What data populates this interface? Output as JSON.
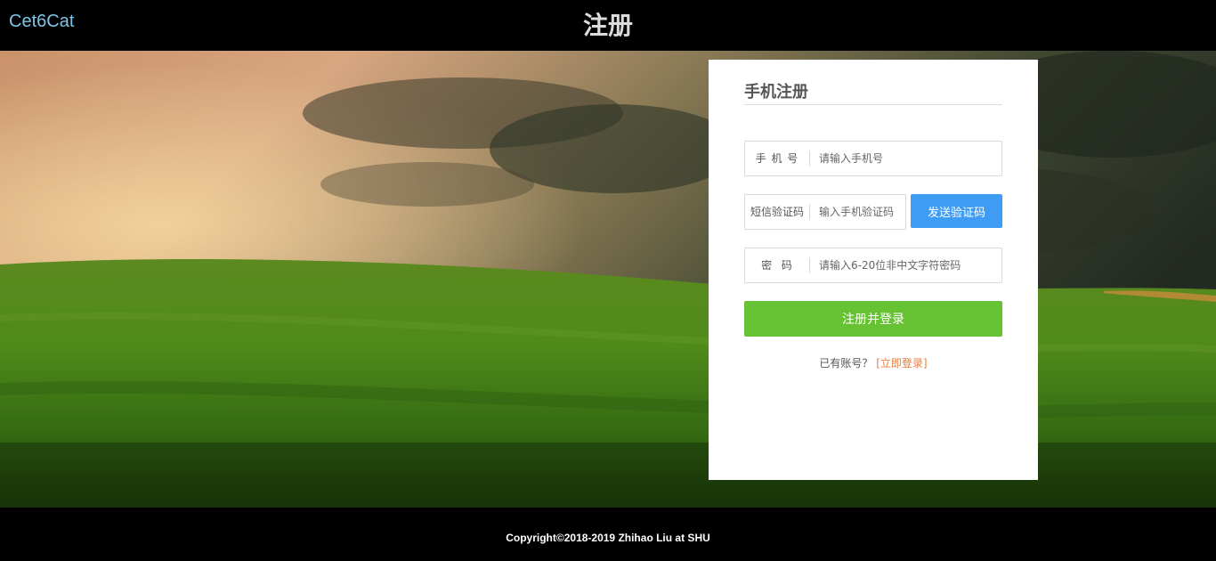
{
  "header": {
    "brand": "Cet6Cat",
    "title": "注册"
  },
  "form": {
    "title": "手机注册",
    "phone": {
      "label": "手 机 号",
      "placeholder": "请输入手机号"
    },
    "sms_code": {
      "label": "短信验证码",
      "placeholder": "输入手机验证码"
    },
    "send_code_label": "发送验证码",
    "password": {
      "label": "密  码",
      "placeholder": "请输入6-20位非中文字符密码"
    },
    "submit_label": "注册并登录",
    "has_account_text": "已有账号？",
    "login_link": "[立即登录]"
  },
  "footer": {
    "copyright": "Copyright©2018-2019 Zhihao Liu at SHU"
  },
  "colors": {
    "send_button": "#3e9cf5",
    "submit_button": "#66c133",
    "login_link": "#e87b3c",
    "brand": "#7ec4e8"
  }
}
